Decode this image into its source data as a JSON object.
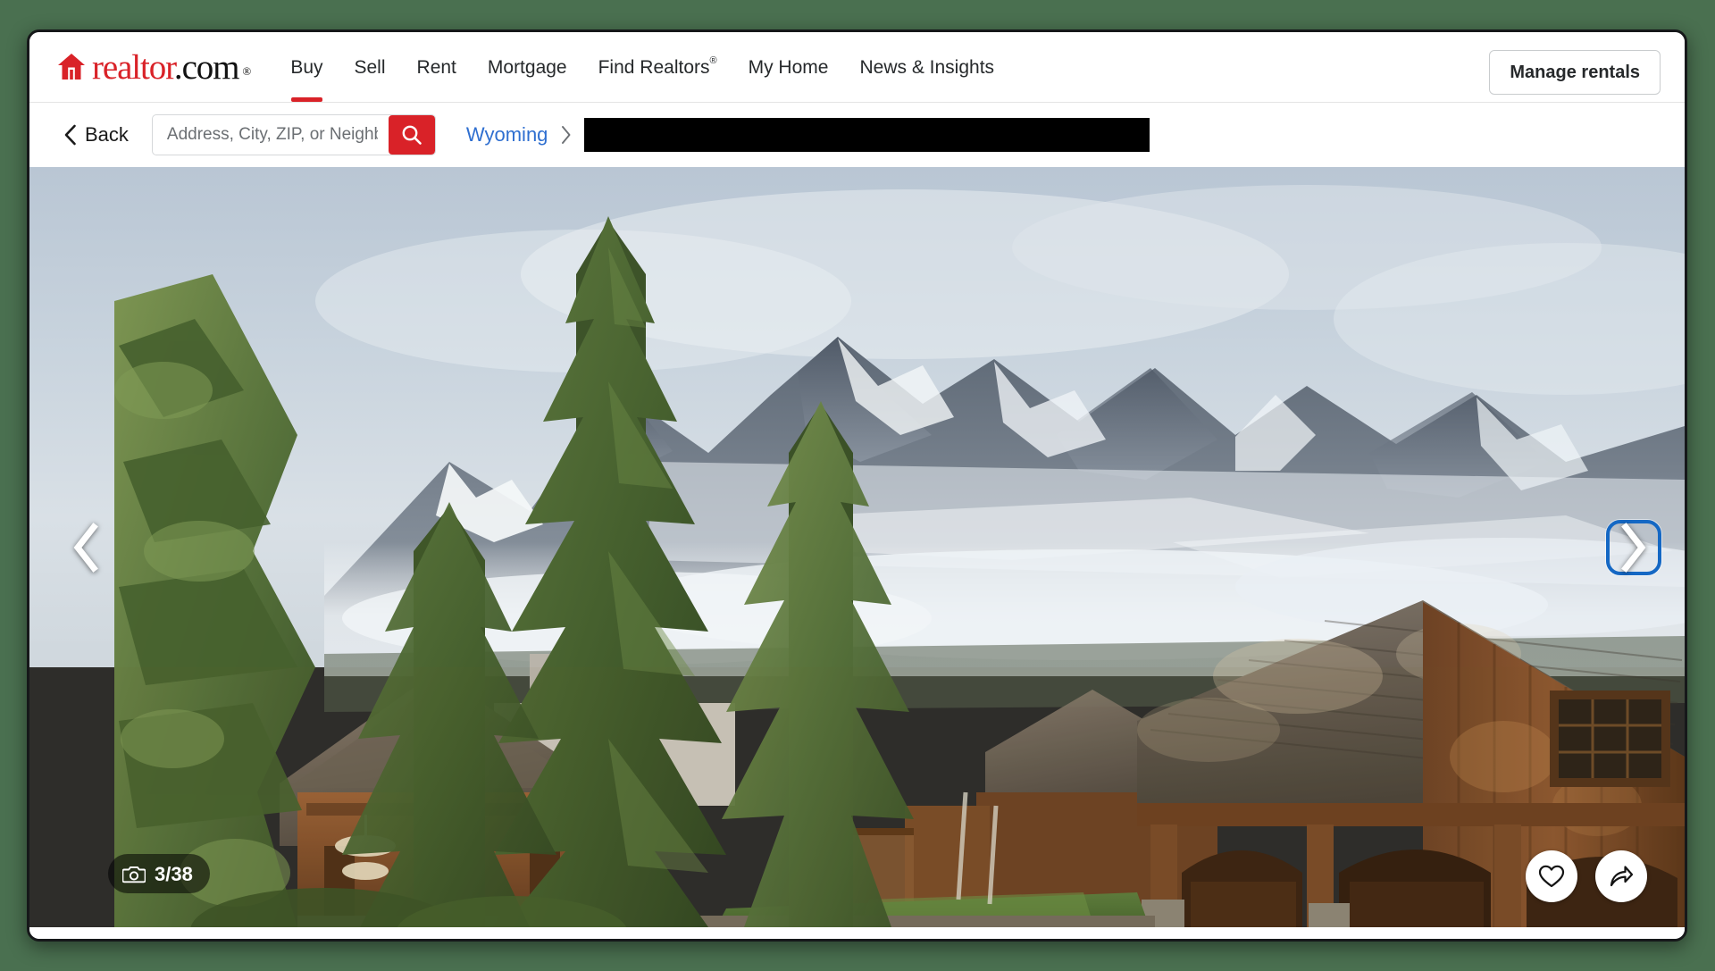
{
  "window": {
    "background_color": "#4a7050",
    "frame_color": "#16181a"
  },
  "header": {
    "brand": {
      "icon": "house-icon",
      "text_red": "realtor",
      "text_black": ".com",
      "registered_mark": "®",
      "red": "#d92228"
    },
    "nav": [
      {
        "label": "Buy",
        "active": true
      },
      {
        "label": "Sell",
        "active": false
      },
      {
        "label": "Rent",
        "active": false
      },
      {
        "label": "Mortgage",
        "active": false
      },
      {
        "label": "Find Realtors",
        "superscript": "®",
        "active": false
      },
      {
        "label": "My Home",
        "active": false
      },
      {
        "label": "News & Insights",
        "active": false
      }
    ],
    "manage_rentals_label": "Manage rentals"
  },
  "search_bar": {
    "back_label": "Back",
    "search_placeholder": "Address, City, ZIP, or Neighborhood",
    "search_value": "",
    "search_icon": "magnifier-icon",
    "submit_color": "#d92228"
  },
  "breadcrumb": {
    "state": "Wyoming",
    "state_color": "#2f6fd0",
    "separator": "chevron-right-icon",
    "redacted_segment": ""
  },
  "gallery": {
    "photo_alt": "Exterior of a rustic timber-and-shingle mountain lodge with evergreen trees and snow-capped peaks behind",
    "counter_current": 3,
    "counter_total": 38,
    "counter_text": "3/38",
    "counter_icon": "camera-icon",
    "prev_label": "Previous photo",
    "next_label": "Next photo",
    "next_focused": true,
    "focus_ring_color": "#1568c4",
    "actions": [
      {
        "name": "save-button",
        "icon": "heart-icon"
      },
      {
        "name": "share-button",
        "icon": "share-arrow-icon"
      }
    ]
  }
}
